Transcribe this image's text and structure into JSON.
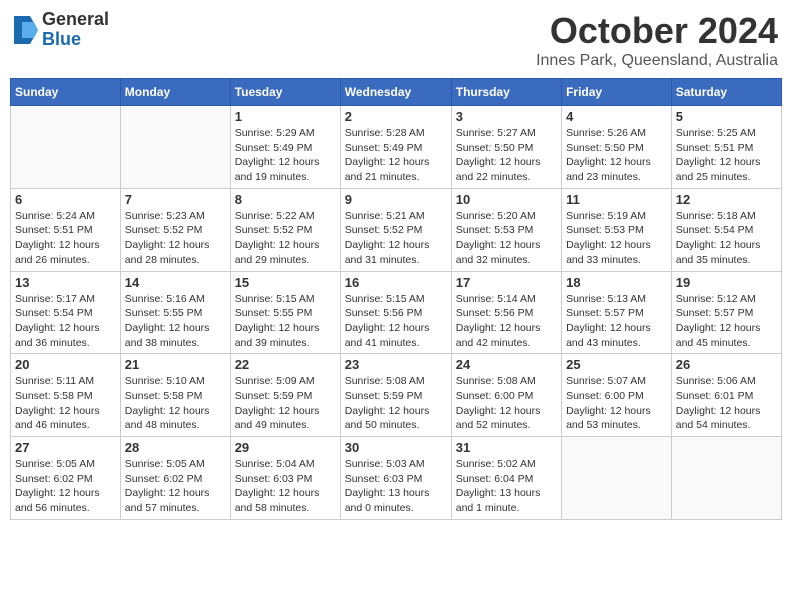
{
  "logo": {
    "general": "General",
    "blue": "Blue"
  },
  "title": "October 2024",
  "subtitle": "Innes Park, Queensland, Australia",
  "days_header": [
    "Sunday",
    "Monday",
    "Tuesday",
    "Wednesday",
    "Thursday",
    "Friday",
    "Saturday"
  ],
  "weeks": [
    [
      {
        "day": "",
        "detail": ""
      },
      {
        "day": "",
        "detail": ""
      },
      {
        "day": "1",
        "detail": "Sunrise: 5:29 AM\nSunset: 5:49 PM\nDaylight: 12 hours\nand 19 minutes."
      },
      {
        "day": "2",
        "detail": "Sunrise: 5:28 AM\nSunset: 5:49 PM\nDaylight: 12 hours\nand 21 minutes."
      },
      {
        "day": "3",
        "detail": "Sunrise: 5:27 AM\nSunset: 5:50 PM\nDaylight: 12 hours\nand 22 minutes."
      },
      {
        "day": "4",
        "detail": "Sunrise: 5:26 AM\nSunset: 5:50 PM\nDaylight: 12 hours\nand 23 minutes."
      },
      {
        "day": "5",
        "detail": "Sunrise: 5:25 AM\nSunset: 5:51 PM\nDaylight: 12 hours\nand 25 minutes."
      }
    ],
    [
      {
        "day": "6",
        "detail": "Sunrise: 5:24 AM\nSunset: 5:51 PM\nDaylight: 12 hours\nand 26 minutes."
      },
      {
        "day": "7",
        "detail": "Sunrise: 5:23 AM\nSunset: 5:52 PM\nDaylight: 12 hours\nand 28 minutes."
      },
      {
        "day": "8",
        "detail": "Sunrise: 5:22 AM\nSunset: 5:52 PM\nDaylight: 12 hours\nand 29 minutes."
      },
      {
        "day": "9",
        "detail": "Sunrise: 5:21 AM\nSunset: 5:52 PM\nDaylight: 12 hours\nand 31 minutes."
      },
      {
        "day": "10",
        "detail": "Sunrise: 5:20 AM\nSunset: 5:53 PM\nDaylight: 12 hours\nand 32 minutes."
      },
      {
        "day": "11",
        "detail": "Sunrise: 5:19 AM\nSunset: 5:53 PM\nDaylight: 12 hours\nand 33 minutes."
      },
      {
        "day": "12",
        "detail": "Sunrise: 5:18 AM\nSunset: 5:54 PM\nDaylight: 12 hours\nand 35 minutes."
      }
    ],
    [
      {
        "day": "13",
        "detail": "Sunrise: 5:17 AM\nSunset: 5:54 PM\nDaylight: 12 hours\nand 36 minutes."
      },
      {
        "day": "14",
        "detail": "Sunrise: 5:16 AM\nSunset: 5:55 PM\nDaylight: 12 hours\nand 38 minutes."
      },
      {
        "day": "15",
        "detail": "Sunrise: 5:15 AM\nSunset: 5:55 PM\nDaylight: 12 hours\nand 39 minutes."
      },
      {
        "day": "16",
        "detail": "Sunrise: 5:15 AM\nSunset: 5:56 PM\nDaylight: 12 hours\nand 41 minutes."
      },
      {
        "day": "17",
        "detail": "Sunrise: 5:14 AM\nSunset: 5:56 PM\nDaylight: 12 hours\nand 42 minutes."
      },
      {
        "day": "18",
        "detail": "Sunrise: 5:13 AM\nSunset: 5:57 PM\nDaylight: 12 hours\nand 43 minutes."
      },
      {
        "day": "19",
        "detail": "Sunrise: 5:12 AM\nSunset: 5:57 PM\nDaylight: 12 hours\nand 45 minutes."
      }
    ],
    [
      {
        "day": "20",
        "detail": "Sunrise: 5:11 AM\nSunset: 5:58 PM\nDaylight: 12 hours\nand 46 minutes."
      },
      {
        "day": "21",
        "detail": "Sunrise: 5:10 AM\nSunset: 5:58 PM\nDaylight: 12 hours\nand 48 minutes."
      },
      {
        "day": "22",
        "detail": "Sunrise: 5:09 AM\nSunset: 5:59 PM\nDaylight: 12 hours\nand 49 minutes."
      },
      {
        "day": "23",
        "detail": "Sunrise: 5:08 AM\nSunset: 5:59 PM\nDaylight: 12 hours\nand 50 minutes."
      },
      {
        "day": "24",
        "detail": "Sunrise: 5:08 AM\nSunset: 6:00 PM\nDaylight: 12 hours\nand 52 minutes."
      },
      {
        "day": "25",
        "detail": "Sunrise: 5:07 AM\nSunset: 6:00 PM\nDaylight: 12 hours\nand 53 minutes."
      },
      {
        "day": "26",
        "detail": "Sunrise: 5:06 AM\nSunset: 6:01 PM\nDaylight: 12 hours\nand 54 minutes."
      }
    ],
    [
      {
        "day": "27",
        "detail": "Sunrise: 5:05 AM\nSunset: 6:02 PM\nDaylight: 12 hours\nand 56 minutes."
      },
      {
        "day": "28",
        "detail": "Sunrise: 5:05 AM\nSunset: 6:02 PM\nDaylight: 12 hours\nand 57 minutes."
      },
      {
        "day": "29",
        "detail": "Sunrise: 5:04 AM\nSunset: 6:03 PM\nDaylight: 12 hours\nand 58 minutes."
      },
      {
        "day": "30",
        "detail": "Sunrise: 5:03 AM\nSunset: 6:03 PM\nDaylight: 13 hours\nand 0 minutes."
      },
      {
        "day": "31",
        "detail": "Sunrise: 5:02 AM\nSunset: 6:04 PM\nDaylight: 13 hours\nand 1 minute."
      },
      {
        "day": "",
        "detail": ""
      },
      {
        "day": "",
        "detail": ""
      }
    ]
  ]
}
